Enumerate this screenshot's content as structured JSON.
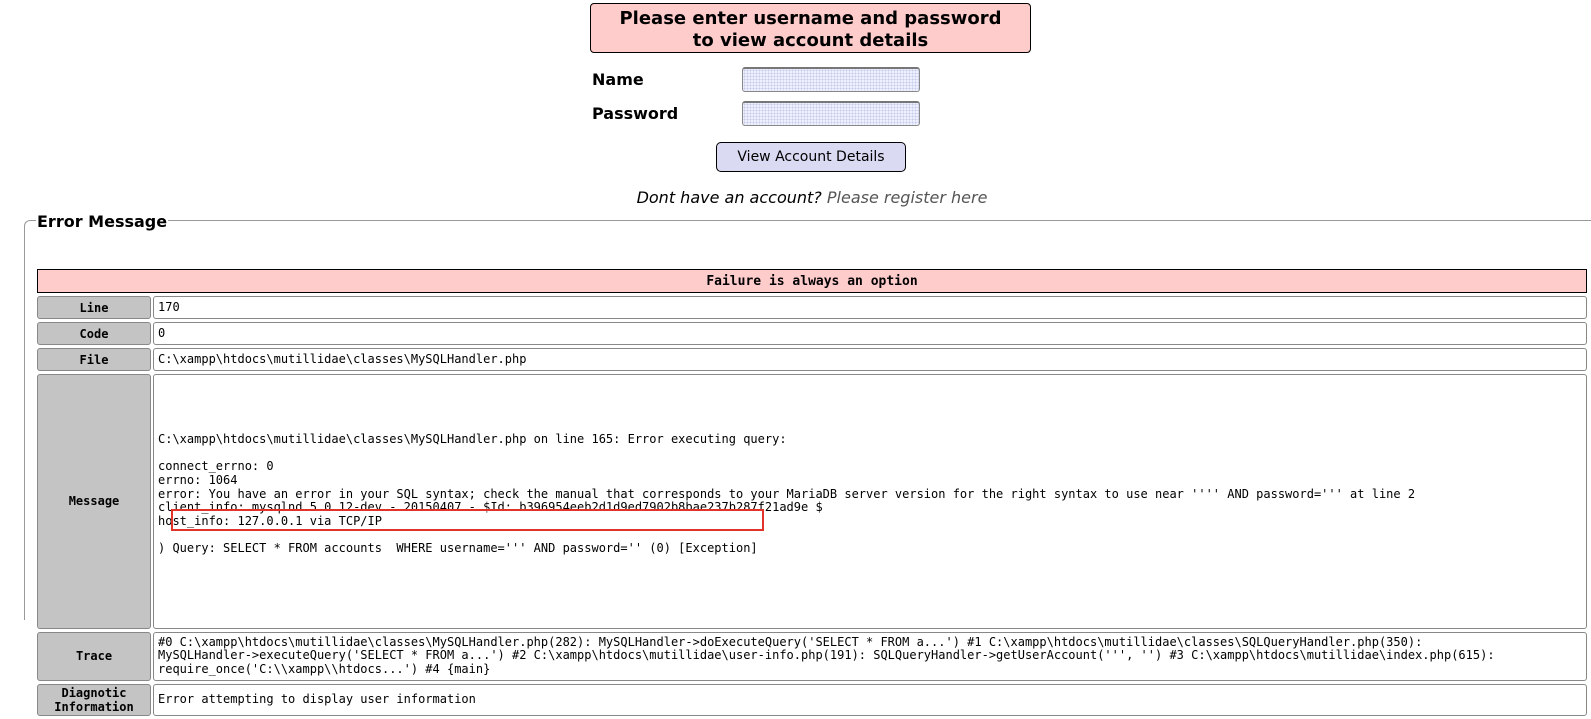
{
  "login": {
    "heading_line1": "Please enter username and password",
    "heading_line2": "to view account details",
    "name_label": "Name",
    "password_label": "Password",
    "name_value": "",
    "password_value": "",
    "submit_label": "View Account Details",
    "register_prompt": "Dont have an account?",
    "register_link": "Please register here"
  },
  "error": {
    "legend": "Error Message",
    "banner": "Failure is always an option",
    "rows": {
      "line": {
        "label": "Line",
        "value": "170"
      },
      "code": {
        "label": "Code",
        "value": "0"
      },
      "file": {
        "label": "File",
        "value": "C:\\xampp\\htdocs\\mutillidae\\classes\\MySQLHandler.php"
      },
      "message": {
        "label": "Message",
        "value": "C:\\xampp\\htdocs\\mutillidae\\classes\\MySQLHandler.php on line 165: Error executing query:\n\nconnect_errno: 0\nerrno: 1064\nerror: You have an error in your SQL syntax; check the manual that corresponds to your MariaDB server version for the right syntax to use near '''' AND password=''' at line 2\nclient_info: mysqlnd 5.0.12-dev - 20150407 - $Id: b396954eeb2d1d9ed7902b8bae237b287f21ad9e $\nhost_info: 127.0.0.1 via TCP/IP\n\n) Query: SELECT * FROM accounts  WHERE username=''' AND password='' (0) [Exception]"
      },
      "trace": {
        "label": "Trace",
        "value": "#0 C:\\xampp\\htdocs\\mutillidae\\classes\\MySQLHandler.php(282): MySQLHandler->doExecuteQuery('SELECT * FROM a...') #1 C:\\xampp\\htdocs\\mutillidae\\classes\\SQLQueryHandler.php(350):\nMySQLHandler->executeQuery('SELECT * FROM a...') #2 C:\\xampp\\htdocs\\mutillidae\\user-info.php(191): SQLQueryHandler->getUserAccount(''', '') #3 C:\\xampp\\htdocs\\mutillidae\\index.php(615):\nrequire_once('C:\\\\xampp\\\\htdocs...') #4 {main}"
      },
      "diagnostic": {
        "label_line1": "Diagnotic",
        "label_line2": "Information",
        "value": "Error attempting to display user information"
      }
    }
  },
  "colors": {
    "header_bg": "#ffcccc",
    "label_bg": "#c4c4c4",
    "button_bg": "#dadaf3",
    "highlight_border": "#e0342a"
  }
}
